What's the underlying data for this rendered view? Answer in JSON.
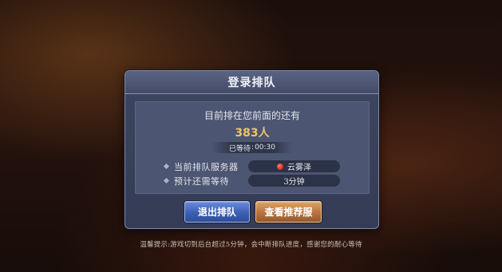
{
  "dialog": {
    "title": "登录排队",
    "queue_label": "目前排在您前面的还有",
    "queue_count": "383人",
    "waited_label": "已等待",
    "waited_time": "00:30",
    "current_server_label": "当前排队服务器",
    "current_server_value": "云雾泽",
    "estimated_wait_label": "预计还需等待",
    "estimated_wait_value": "3分钟",
    "exit_button_label": "退出排队",
    "recommend_button_label": "查看推荐服"
  },
  "tip": "温馨提示:游戏切到后台超过5分钟，会中断排队进度，感谢您的耐心等待",
  "colors": {
    "queue_count": "#f0c36a",
    "server_status_dot": "#e0322a",
    "exit_button": "#3d5fb3",
    "recommend_button": "#b7743f"
  }
}
